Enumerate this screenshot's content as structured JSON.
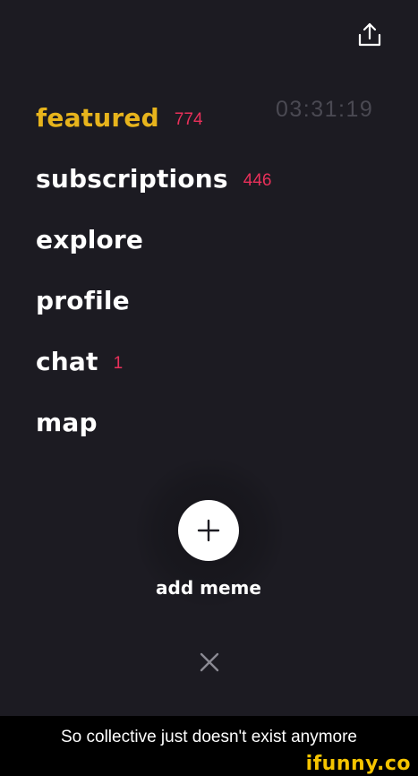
{
  "header": {
    "share_icon": "share-icon"
  },
  "menu": {
    "items": [
      {
        "label": "featured",
        "count": "774",
        "active": true
      },
      {
        "label": "subscriptions",
        "count": "446",
        "active": false
      },
      {
        "label": "explore",
        "count": null,
        "active": false
      },
      {
        "label": "profile",
        "count": null,
        "active": false
      },
      {
        "label": "chat",
        "count": "1",
        "active": false
      },
      {
        "label": "map",
        "count": null,
        "active": false
      }
    ]
  },
  "timer": "03:31:19",
  "add_meme": {
    "icon": "plus-icon",
    "label": "add meme"
  },
  "close": {
    "icon": "close-icon"
  },
  "caption": "So collective just doesn't exist anymore",
  "watermark": "ifunny.co",
  "colors": {
    "background": "#1c1b22",
    "active": "#e7b41c",
    "count": "#e8305a",
    "timer": "#4a4952",
    "text": "#ffffff",
    "watermark": "#f5c400"
  }
}
